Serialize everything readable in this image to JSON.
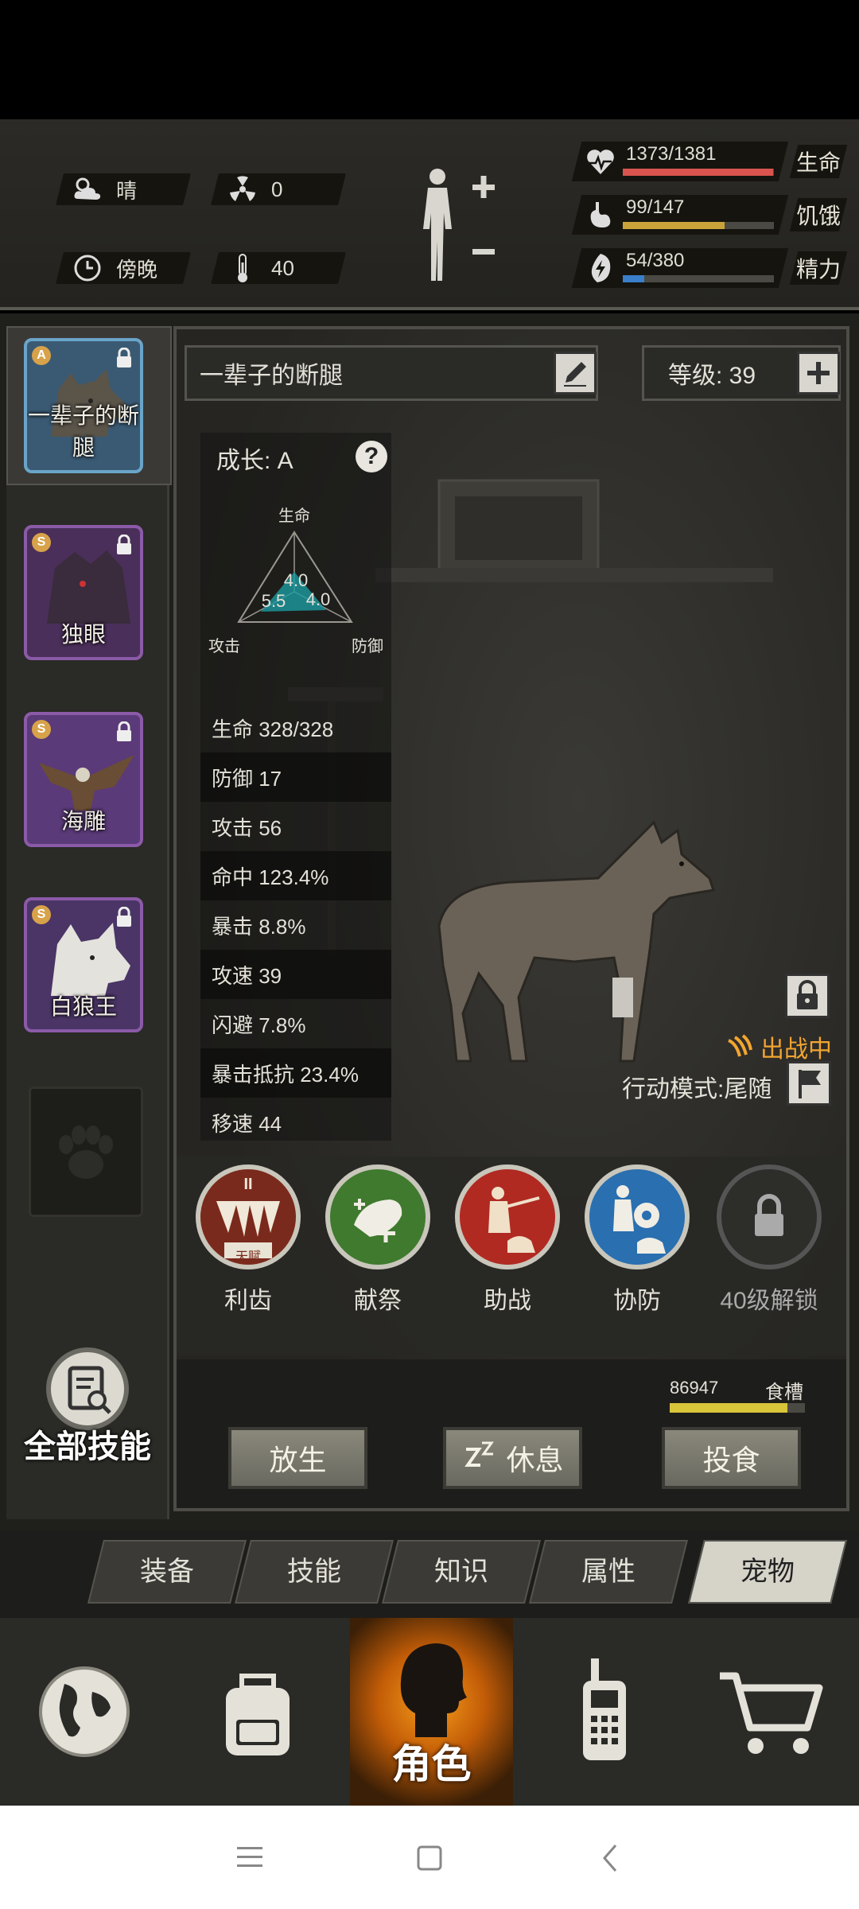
{
  "hud": {
    "weather": "晴",
    "radiation": "0",
    "time_of_day": "傍晚",
    "temperature": "40",
    "vitals": [
      {
        "value": "1373/1381",
        "label": "生命",
        "fraction": 0.994,
        "color": "#d9534f"
      },
      {
        "value": "99/147",
        "label": "饥饿",
        "fraction": 0.673,
        "color": "#c9a33a"
      },
      {
        "value": "54/380",
        "label": "精力",
        "fraction": 0.142,
        "color": "#3a7fc9"
      }
    ]
  },
  "pets": [
    {
      "name": "一辈子的断腿",
      "rank": "A",
      "rank_color": "#d7a24a",
      "bg": "#3a5a73",
      "border": "#6aa5c9"
    },
    {
      "name": "独眼",
      "rank": "S",
      "rank_color": "#d7a24a",
      "bg": "#4a2f5a",
      "border": "#8b5aa8"
    },
    {
      "name": "海雕",
      "rank": "S",
      "rank_color": "#d7a24a",
      "bg": "#5a3a78",
      "border": "#8b5aa8"
    },
    {
      "name": "白狼王",
      "rank": "S",
      "rank_color": "#d7a24a",
      "bg": "#4a3566",
      "border": "#8b5aa8"
    }
  ],
  "all_skills_label": "全部技能",
  "detail": {
    "pet_name": "一辈子的断腿",
    "level_label": "等级: 39",
    "growth_label": "成长: A",
    "radar": {
      "top": "生命",
      "left": "攻击",
      "right": "防御",
      "v1": "4.0",
      "v2": "5.5",
      "v3": "4.0"
    },
    "stats": [
      "生命 328/328",
      "防御 17",
      "攻击 56",
      "命中 123.4%",
      "暴击 8.8%",
      "攻速 39",
      "闪避 7.8%",
      "暴击抵抗 23.4%",
      "移速 44"
    ],
    "deployed_label": "出战中",
    "mode_label": "行动模式:尾随",
    "skills": [
      {
        "label": "利齿",
        "badge": "天赋",
        "roman": "II"
      },
      {
        "label": "献祭"
      },
      {
        "label": "助战"
      },
      {
        "label": "协防"
      },
      {
        "label": "40级解锁"
      }
    ],
    "food_value": "86947",
    "food_label": "食槽",
    "food_fraction": 0.87,
    "buttons": {
      "release": "放生",
      "rest": "休息",
      "feed": "投食"
    }
  },
  "tabs": [
    "装备",
    "技能",
    "知识",
    "属性",
    "宠物"
  ],
  "active_tab": 4,
  "bottom_nav": {
    "center_label": "角色"
  }
}
